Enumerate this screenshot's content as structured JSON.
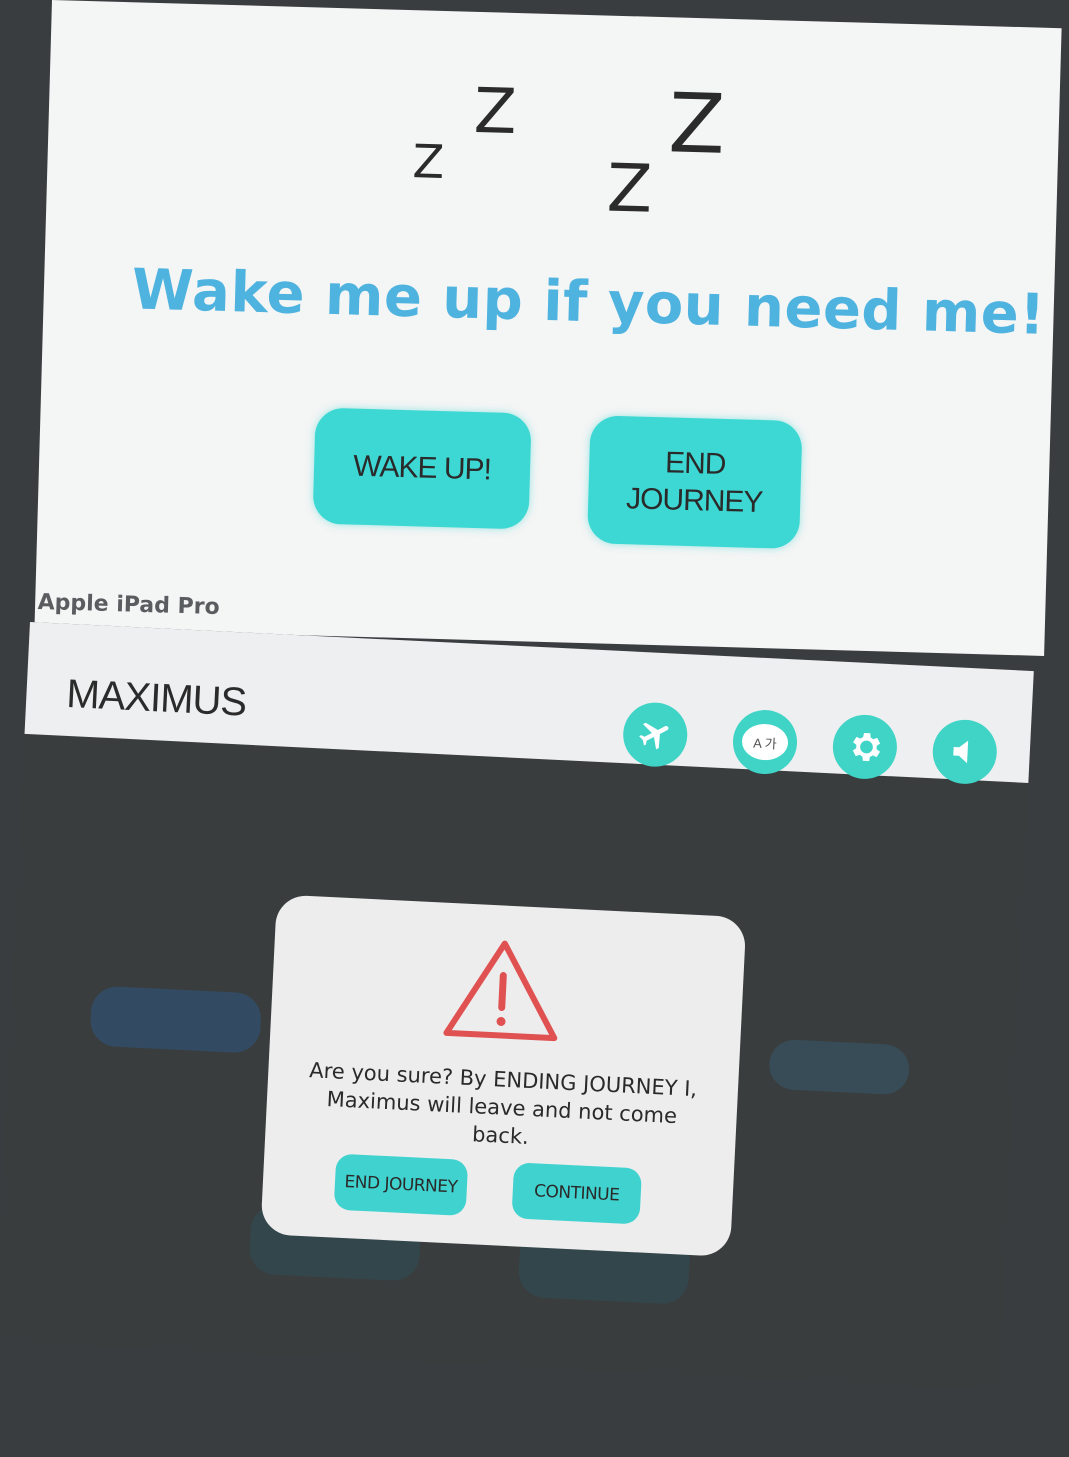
{
  "sleep_screen": {
    "zzz": [
      "Z",
      "Z",
      "Z",
      "Z"
    ],
    "message": "Wake me up if you need me!",
    "wake_button": "WAKE UP!",
    "end_button": "END JOURNEY"
  },
  "device_label": "Apple iPad Pro",
  "app": {
    "title": "MAXIMUS",
    "icons": [
      "airplane-icon",
      "translate-icon",
      "gear-icon",
      "sound-icon"
    ],
    "translate_glyph": "A 가",
    "accent_color": "#3fd4c6"
  },
  "modal": {
    "message": "Are you sure? By ENDING JOURNEY I, Maximus will leave and not come back.",
    "end_button": "END JOURNEY",
    "continue_button": "CONTINUE",
    "warning_color": "#e05252"
  },
  "colors": {
    "heading_blue": "#4fb3df",
    "button_teal": "#3ed8d4"
  }
}
